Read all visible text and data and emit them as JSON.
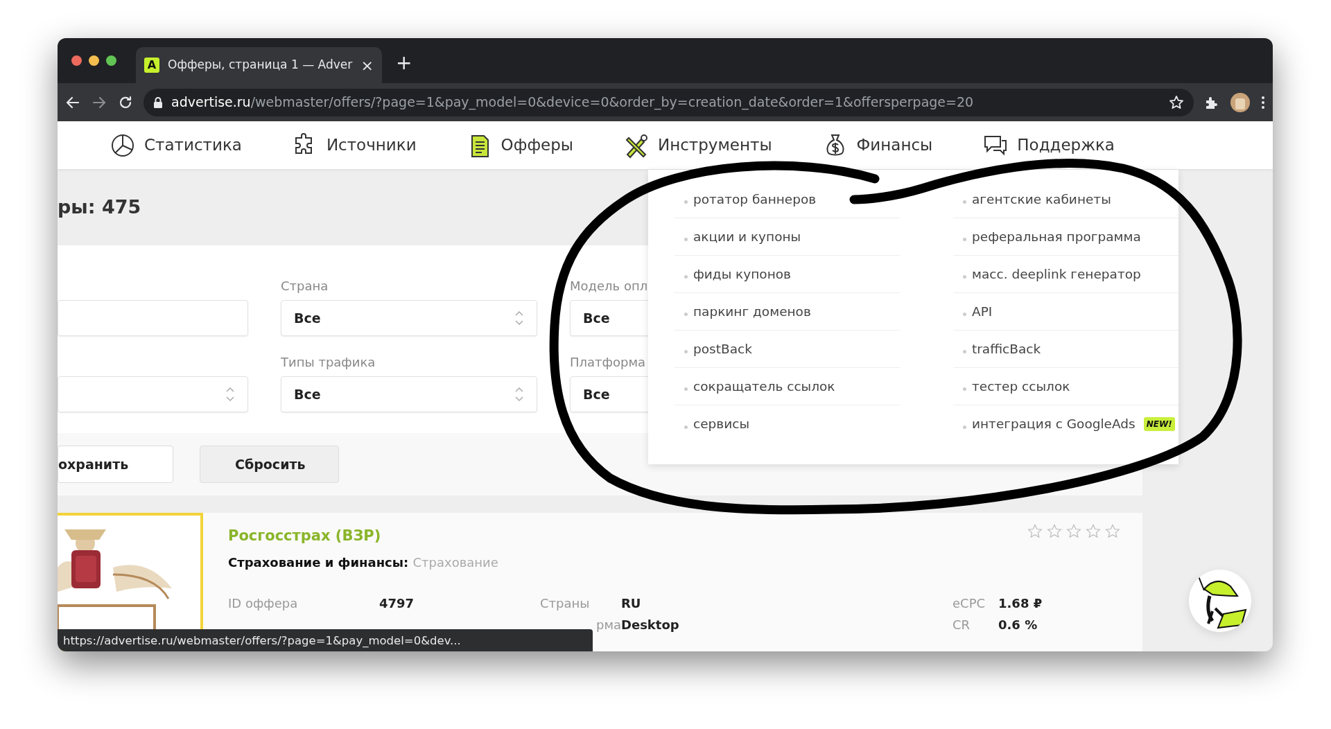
{
  "browser": {
    "tab": {
      "favicon": "A",
      "title": "Офферы, страница 1 — Adver",
      "close": "×",
      "selected": true
    },
    "new_tab": "+",
    "url": {
      "host": "advertise.ru",
      "path": "/webmaster/offers/?page=1&pay_model=0&device=0&order_by=creation_date&order=1&offersperpage=20"
    }
  },
  "nav": [
    {
      "label": "Статистика",
      "kind": "pie"
    },
    {
      "label": "Источники",
      "kind": "puzzle"
    },
    {
      "label": "Офферы",
      "kind": "document"
    },
    {
      "label": "Инструменты",
      "kind": "tools"
    },
    {
      "label": "Финансы",
      "kind": "moneybag"
    },
    {
      "label": "Поддержка",
      "kind": "chat"
    }
  ],
  "heading": "ры: 475",
  "filters": [
    [
      {
        "kind": "input"
      },
      {
        "kind": "select"
      }
    ],
    [
      {
        "kind": "select",
        "label": "Страна",
        "value": "Все"
      },
      {
        "kind": "select",
        "label": "Типы трафика",
        "value": "Все"
      }
    ],
    [
      {
        "kind": "select",
        "label": "Модель опл",
        "value": "Все"
      },
      {
        "kind": "select",
        "label": "Платформа",
        "value": "Все"
      }
    ]
  ],
  "buttons": [
    {
      "label": "охранить",
      "kind": "plain"
    },
    {
      "label": "Сбросить",
      "kind": "grey"
    }
  ],
  "tools_menu": [
    [
      {
        "label": "ротатор баннеров"
      },
      {
        "label": "акции и купоны"
      },
      {
        "label": "фиды купонов"
      },
      {
        "label": "паркинг доменов"
      },
      {
        "label": "postBack"
      },
      {
        "label": "сокращатель ссылок"
      },
      {
        "label": "сервисы"
      }
    ],
    [
      {
        "label": "агентские кабинеты"
      },
      {
        "label": "реферальная программа"
      },
      {
        "label": "масс. deeplink генератор"
      },
      {
        "label": "API"
      },
      {
        "label": "trafficBack"
      },
      {
        "label": "тестер ссылок"
      },
      {
        "label": "интеграция с GoogleAds",
        "badge": "NEW!"
      }
    ]
  ],
  "offer": {
    "kind": "picture",
    "title": "Росгосстрах (ВЗР)",
    "category": "Страхование и финансы:",
    "subcategory": "Страхование",
    "stars": 0,
    "fields": [
      {
        "label": "ID оффера",
        "value": "4797"
      },
      {
        "label": "Страны",
        "value": "RU"
      },
      {
        "label": "рма",
        "value": "Desktop"
      },
      {
        "label": "eCPC",
        "value": "1.68 ₽"
      },
      {
        "label": "CR",
        "value": "0.6 %"
      }
    ]
  },
  "status_url": "https://advertise.ru/webmaster/offers/?page=1&pay_model=0&dev..."
}
